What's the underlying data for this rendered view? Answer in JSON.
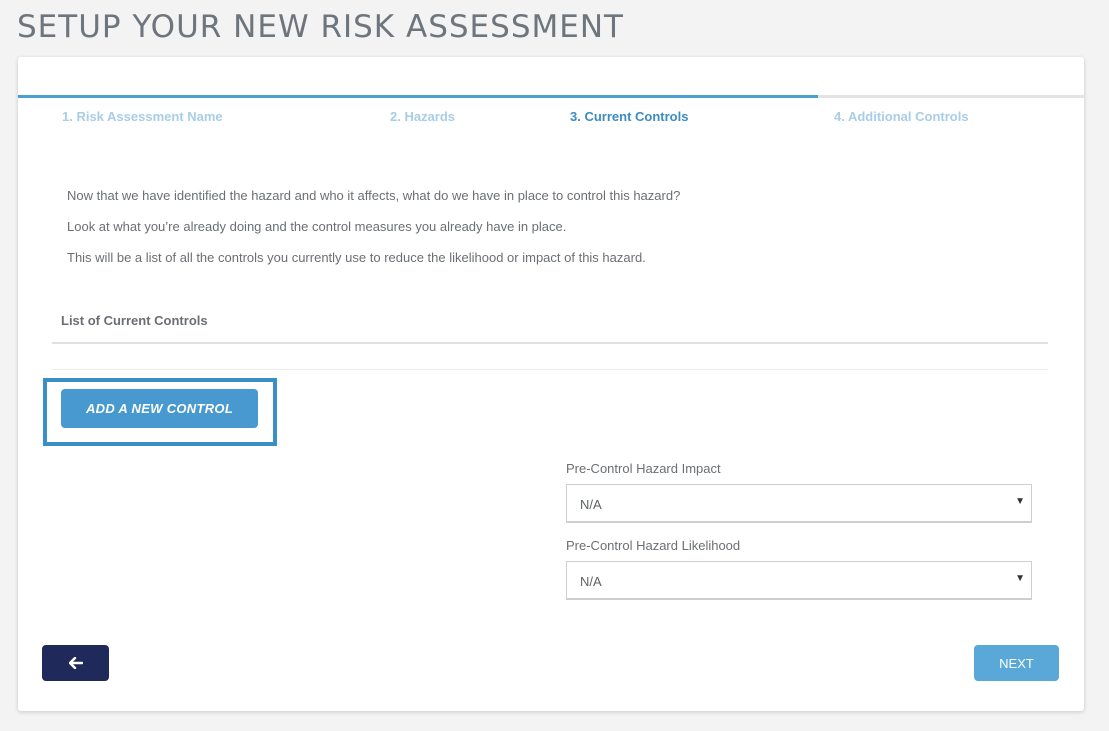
{
  "page": {
    "title": "SETUP YOUR NEW RISK ASSESSMENT"
  },
  "steps": [
    {
      "label": "1. Risk Assessment Name",
      "state": "completed"
    },
    {
      "label": "2. Hazards",
      "state": "completed"
    },
    {
      "label": "3. Current Controls",
      "state": "active"
    },
    {
      "label": "4. Additional Controls",
      "state": "upcoming"
    }
  ],
  "progress": {
    "current_step": 3,
    "total_steps": 4
  },
  "intro": [
    "Now that we have identified the hazard and who it affects, what do we have in place to control this hazard?",
    "Look at what you’re already doing and the control measures you already have in place.",
    "This will be a list of all the controls you currently use to reduce the likelihood or impact of this hazard."
  ],
  "controls_list": {
    "title": "List of Current Controls",
    "add_button_label": "ADD A NEW CONTROL"
  },
  "fields": {
    "impact": {
      "label": "Pre-Control Hazard Impact",
      "value": "N/A"
    },
    "likelihood": {
      "label": "Pre-Control Hazard Likelihood",
      "value": "N/A"
    }
  },
  "icons": {
    "back": "arrow-left-icon",
    "select_caret": "caret-down-icon"
  },
  "nav": {
    "back_symbol": "➔",
    "next_label": "NEXT"
  },
  "colors": {
    "accent": "#4799d0",
    "highlight_border": "#3a8fc9",
    "back_button": "#1f2a5a",
    "next_button": "#5aa8d8",
    "step_active": "#3c8cc2",
    "step_inactive": "#a9cde6"
  }
}
